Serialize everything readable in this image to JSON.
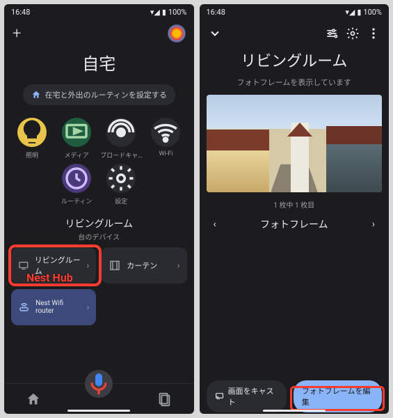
{
  "status": {
    "time": "16:48",
    "battery": "100%"
  },
  "left": {
    "title": "自宅",
    "routine_label": "在宅と外出のルーティンを設定する",
    "categories": [
      {
        "label": "照明",
        "bg": "#e8c54a"
      },
      {
        "label": "メディア",
        "bg": "#1e5e3e"
      },
      {
        "label": "ブロードキャ…",
        "bg": "#2a2b31"
      },
      {
        "label": "Wi-Fi",
        "bg": "#2a2b31"
      },
      {
        "label": "ルーティン",
        "bg": "#4a3a7a"
      },
      {
        "label": "設定",
        "bg": "#2a2b31"
      }
    ],
    "room_header": "リビングルーム",
    "room_sub": "台のデバイス",
    "annotation": "Nest Hub",
    "devices": {
      "living": "リビングルーム",
      "curtain": "カーテン",
      "nest": "Nest Wifi router"
    }
  },
  "right": {
    "title": "リビングルーム",
    "subtitle": "フォトフレームを表示しています",
    "counter": "1 枚中 1 枚目",
    "frame_title": "フォトフレーム",
    "cast_label": "画面をキャスト",
    "edit_label": "フォトフレームを編集"
  }
}
